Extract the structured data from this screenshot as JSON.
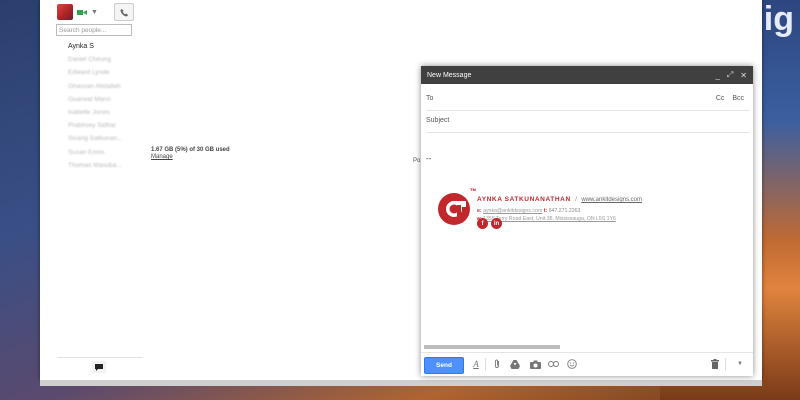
{
  "wallpaper": {
    "text": "ig"
  },
  "chat": {
    "search_placeholder": "Search people...",
    "contacts": [
      "Aynka S",
      "Daniel Cheung",
      "Edward Lynde",
      "Ghassan Abdallah",
      "Guarwat Mann",
      "Isabelle Jones",
      "Prabhsey Sidhar",
      "Sivarig Satkunan...",
      "Susan Ennis",
      "Thomas Masuba..."
    ]
  },
  "storage": {
    "used": "1.67 GB (5%) of 30 GB used",
    "manage": "Manage"
  },
  "background_text": "Po",
  "compose": {
    "title": "New Message",
    "to_label": "To",
    "cc_label": "Cc",
    "bcc_label": "Bcc",
    "subject_label": "Subject",
    "body_dash": "--",
    "send_label": "Send",
    "signature": {
      "tm": "TM",
      "name": "AYNKA SATKUNANATHAN",
      "slash": "/",
      "website": "www.ankitdesigns.com",
      "email_prefix": "e:",
      "email": "aynka@ankitdesigns.com",
      "tel_prefix": "t:",
      "tel": "647.271.2263",
      "address_prefix": "a:",
      "address": "1355 Terry Road East, Unit 38, Mississauga, ON L5S 1Y6",
      "social": [
        "f",
        "in"
      ]
    }
  }
}
